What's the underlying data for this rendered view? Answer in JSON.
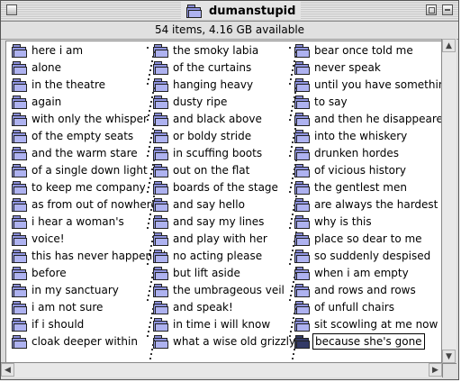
{
  "window": {
    "title": "dumanstupid",
    "status": "54 items, 4.16 GB available"
  },
  "columns": [
    [
      "here i am",
      "alone",
      "in the theatre",
      "again",
      "with only the whisper",
      "of the empty seats",
      "and the warm stare",
      "of a single down light",
      "to keep me company",
      "as from out of nowhere",
      "i hear a woman's",
      "voice!",
      "this has never happened",
      "before",
      "in my sanctuary",
      "i am not sure",
      "if i should",
      "cloak deeper within"
    ],
    [
      "the smoky labia",
      "of the curtains",
      "hanging heavy",
      "dusty ripe",
      "and black above",
      "or boldy stride",
      "in scuffing boots",
      "out on the flat",
      "boards of the stage",
      "and say hello",
      "and say my lines",
      "and play with her",
      "no acting please",
      "but lift aside",
      "the umbrageous veil",
      "and speak!",
      "in time i will know",
      "what a wise old grizzly"
    ],
    [
      "bear once told me",
      "never speak",
      "until you have something",
      "to say",
      "and then he disappeared",
      "into the whiskery",
      "drunken hordes",
      "of vicious history",
      "the gentlest men",
      "are always the hardest",
      "why is this",
      "place so dear to me",
      "so suddenly despised",
      "when i am empty",
      "and rows and rows",
      "of unfull chairs",
      "sit scowling at me now",
      "because she's gone"
    ]
  ],
  "selected": "because she's gone",
  "icons": {
    "folder": "folder-icon",
    "window_folder": "folder-icon",
    "close": "close-box-icon",
    "zoom": "zoom-box-icon",
    "collapse": "collapse-box-icon"
  }
}
